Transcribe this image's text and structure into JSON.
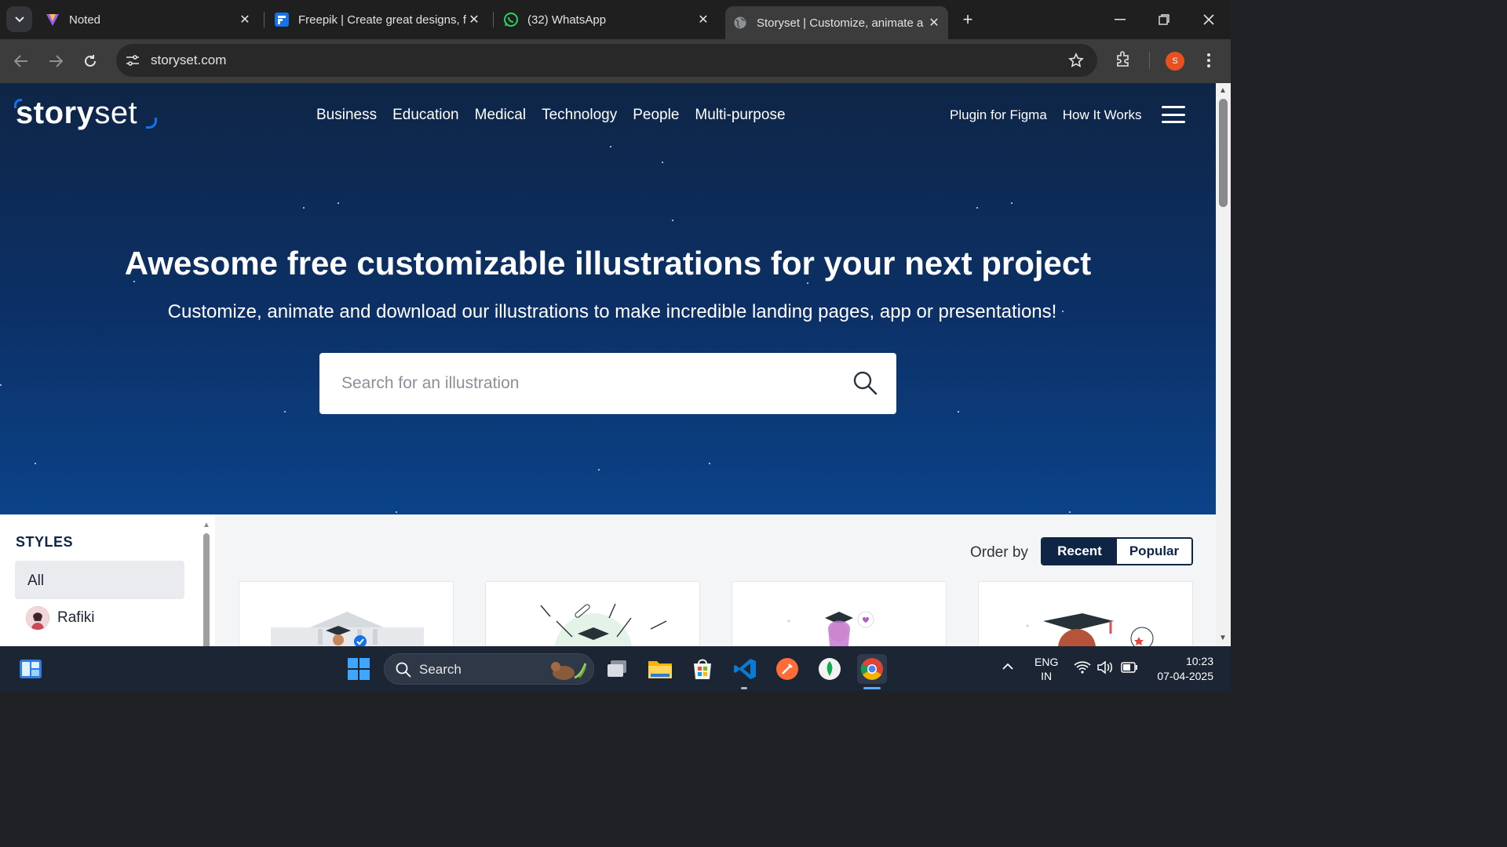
{
  "browser": {
    "tabs": [
      {
        "title": "Noted",
        "icon": "noted-icon"
      },
      {
        "title": "Freepik | Create great designs, f",
        "icon": "freepik-icon"
      },
      {
        "title": "(32) WhatsApp",
        "icon": "whatsapp-icon"
      },
      {
        "title": "Storyset | Customize, animate a",
        "icon": "globe-icon",
        "active": true
      }
    ],
    "url": "storyset.com",
    "profile_initial": "S"
  },
  "site": {
    "logo_main": "story",
    "logo_rest": "set",
    "nav": [
      "Business",
      "Education",
      "Medical",
      "Technology",
      "People",
      "Multi-purpose"
    ],
    "nav_right": [
      "Plugin for Figma",
      "How It Works"
    ],
    "hero_title": "Awesome free customizable illustrations for your next project",
    "hero_subtitle": "Customize, animate and download our illustrations to make incredible landing pages, app or presentations!",
    "search_placeholder": "Search for an illustration",
    "styles_heading": "STYLES",
    "styles": [
      "All",
      "Rafiki"
    ],
    "order_by_label": "Order by",
    "order_options": [
      "Recent",
      "Popular"
    ],
    "colors": {
      "hero_top": "#0e2546",
      "hero_bottom": "#0b4389",
      "accent": "#1273eb",
      "dark": "#0e2546"
    }
  },
  "taskbar": {
    "search_label": "Search",
    "lang_top": "ENG",
    "lang_bottom": "IN",
    "time": "10:23",
    "date": "07-04-2025"
  }
}
